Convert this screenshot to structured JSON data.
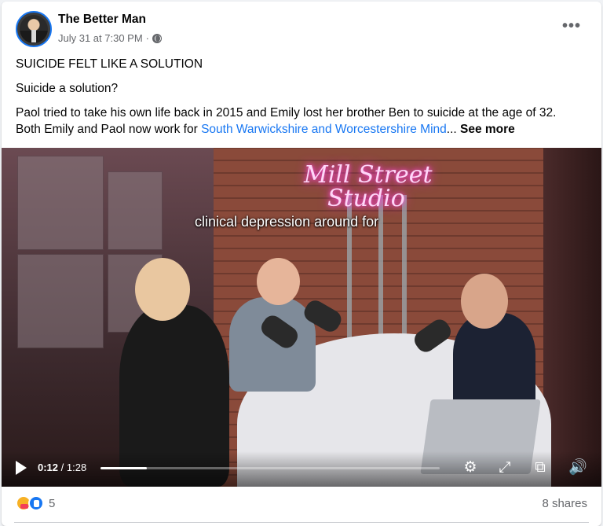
{
  "post": {
    "author": "The Better Man",
    "timestamp": "July 31 at 7:30 PM",
    "separator": "·",
    "privacy_icon": "globe-icon",
    "more_icon": "ellipsis-icon",
    "title_line": "SUICIDE FELT LIKE A SOLUTION",
    "subtitle_line": "Suicide a solution?",
    "body_text": "Paol tried to take his own life back in 2015 and Emily lost her brother Ben to suicide at the age of 32. Both Emily and Paol now work for ",
    "body_link": "South Warwickshire and Worcestershire Mind",
    "body_ellipsis": "...",
    "see_more": "See more"
  },
  "video": {
    "neon_sign_line1": "Mill Street",
    "neon_sign_line2": "Studio",
    "caption": "clinical depression around for",
    "current_time": "0:12",
    "time_separator": " / ",
    "duration": "1:28",
    "progress_fraction": 0.136,
    "icons": [
      "play-icon",
      "settings-icon",
      "fullscreen-icon",
      "pip-icon",
      "volume-icon"
    ]
  },
  "footer": {
    "reaction_count": "5",
    "reaction_icons": [
      "care-icon",
      "like-icon"
    ],
    "shares": "8 shares"
  },
  "colors": {
    "link": "#1877f2",
    "secondary_text": "#65676b",
    "neon": "#ff4fd8"
  }
}
